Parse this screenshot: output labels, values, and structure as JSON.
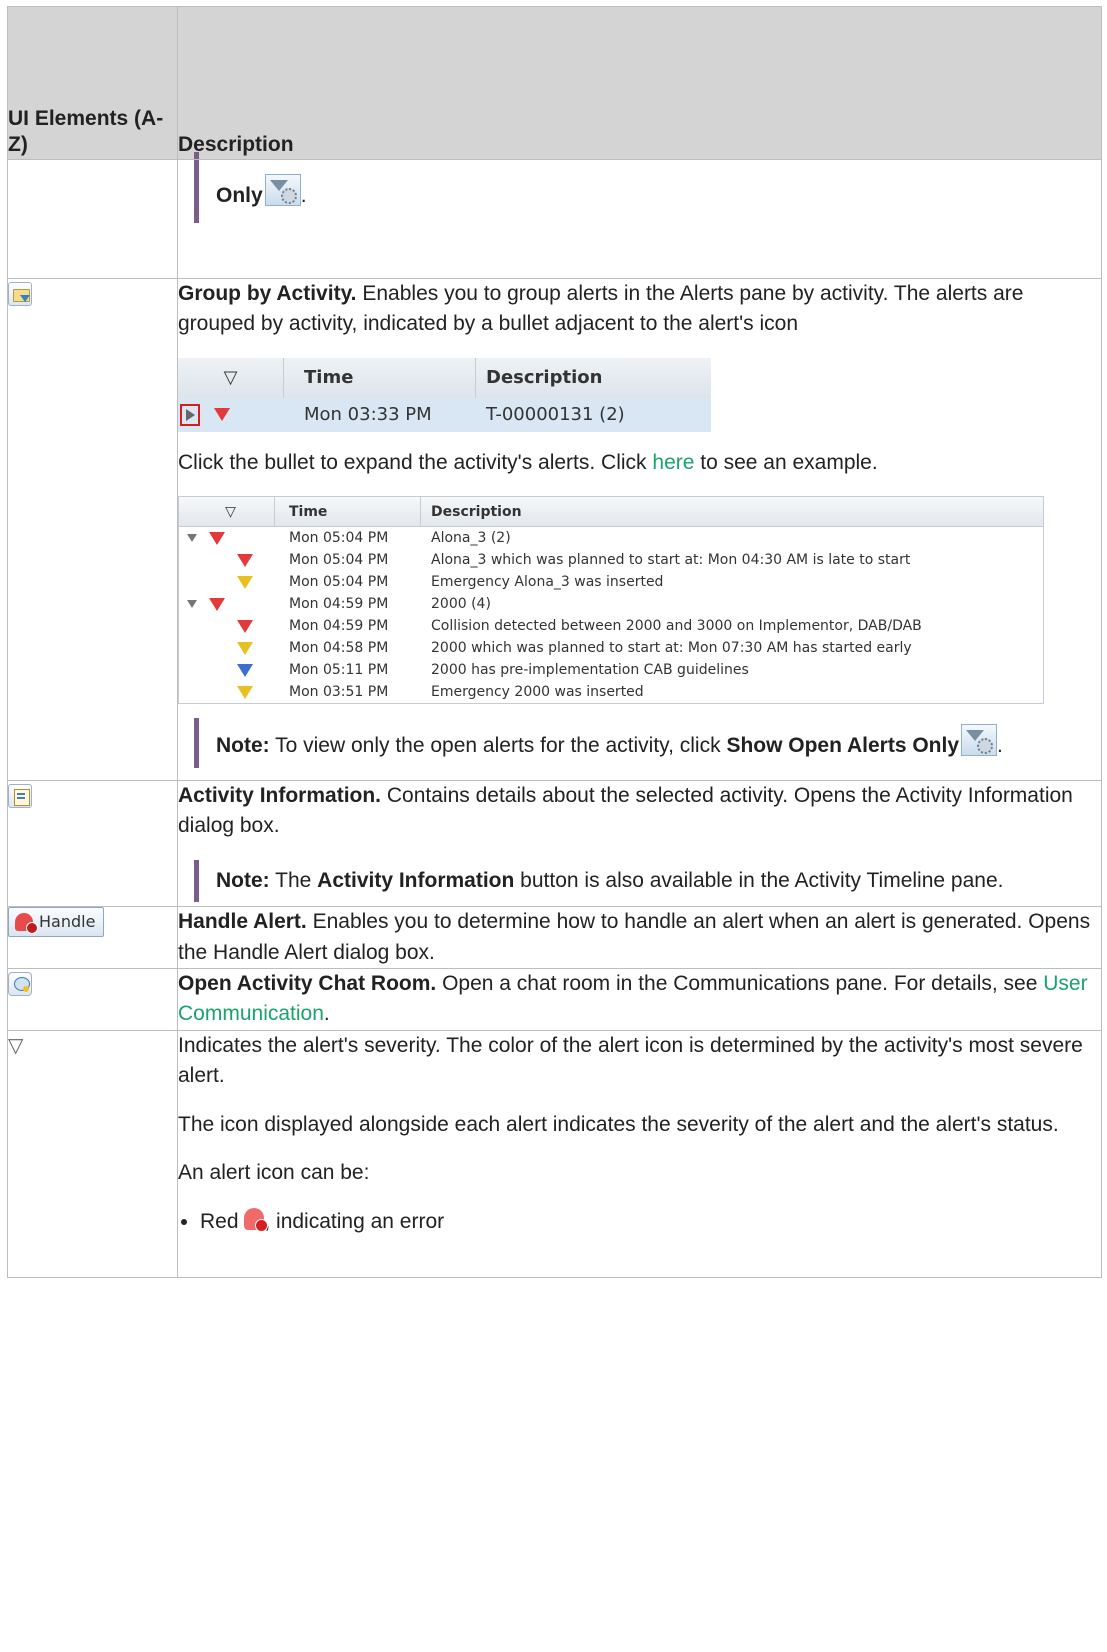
{
  "header": {
    "col1": "UI Elements (A-Z)",
    "col2": "Description"
  },
  "row0": {
    "note_end": "Only",
    "note_end_punct": "."
  },
  "row1": {
    "title": "Group by Activity.",
    "text": " Enables you to group alerts in the Alerts pane by activity. The alerts are grouped by activity, indicated by a bullet adjacent to the alert's icon",
    "shot1": {
      "col_time": "Time",
      "col_desc": "Description",
      "time": "Mon 03:33 PM",
      "desc": "T-00000131 (2)"
    },
    "expand_pre": "Click the bullet to expand the activity's alerts. Click ",
    "expand_link": "here",
    "expand_post": " to see an example.",
    "shot2": {
      "col_time": "Time",
      "col_desc": "Description",
      "rows": [
        {
          "group": true,
          "sev": "red",
          "time": "Mon 05:04 PM",
          "desc": "Alona_3 (2)"
        },
        {
          "group": false,
          "sev": "red",
          "time": "Mon 05:04 PM",
          "desc": "Alona_3 which was planned to start at: Mon 04:30 AM is late to start"
        },
        {
          "group": false,
          "sev": "yellow",
          "time": "Mon 05:04 PM",
          "desc": "Emergency Alona_3 was inserted"
        },
        {
          "group": true,
          "sev": "red",
          "time": "Mon 04:59 PM",
          "desc": "2000 (4)"
        },
        {
          "group": false,
          "sev": "red",
          "time": "Mon 04:59 PM",
          "desc": "Collision detected between 2000 and 3000 on Implementor, DAB/DAB"
        },
        {
          "group": false,
          "sev": "yellow",
          "time": "Mon 04:58 PM",
          "desc": "2000 which was planned to start at: Mon 07:30 AM has started early"
        },
        {
          "group": false,
          "sev": "blue",
          "time": "Mon 05:11 PM",
          "desc": "2000 has pre-implementation CAB guidelines"
        },
        {
          "group": false,
          "sev": "yslash",
          "time": "Mon 03:51 PM",
          "desc": "Emergency 2000 was inserted"
        }
      ]
    },
    "note_label": "Note:",
    "note_text": " To view only the open alerts for the activity, click ",
    "note_bold": "Show Open Alerts Only",
    "note_end": "."
  },
  "row2": {
    "title": "Activity Information.",
    "text": " Contains details about the selected activity. Opens the Activity Information dialog box.",
    "note_label": "Note:",
    "note_pre": " The ",
    "note_bold": "Activity Information",
    "note_post": " button is also available in the Activity Timeline pane."
  },
  "row3": {
    "button_label": "Handle",
    "title": "Handle Alert.",
    "text": " Enables you to determine how to handle an alert when an alert is generated. Opens the Handle Alert dialog box."
  },
  "row4": {
    "title": "Open Activity Chat Room.",
    "text": " Open a chat room in the Communications pane. For details, see ",
    "link": "User Communication",
    "end": "."
  },
  "row5": {
    "icon_glyph": "▽",
    "p1": "Indicates the alert's severity. The color of the alert icon is determined by the activity's most severe alert.",
    "p2": "The icon displayed alongside each alert indicates the severity of the alert and the alert's status.",
    "p3": "An alert icon can be:",
    "bullet_pre": "Red ",
    "bullet_post": ", indicating an error"
  }
}
